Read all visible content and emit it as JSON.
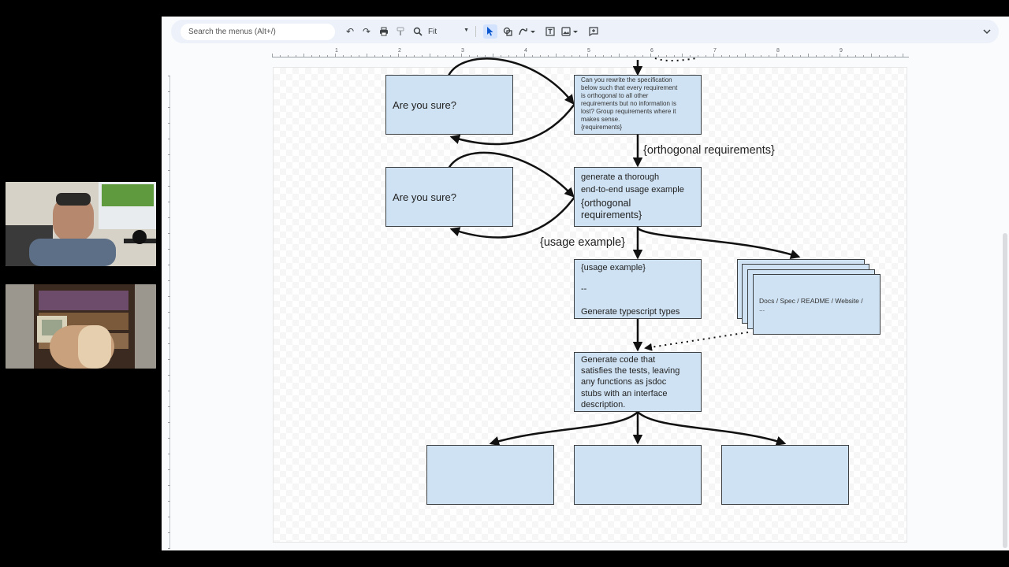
{
  "toolbar": {
    "search_placeholder": "Search the menus (Alt+/)",
    "zoom_value": "Fit"
  },
  "ruler": {
    "labels": [
      "1",
      "2",
      "3",
      "4",
      "5",
      "6",
      "7",
      "8",
      "9"
    ]
  },
  "diagram": {
    "are_you_sure_1": "Are you sure?",
    "are_you_sure_2": "Are you sure?",
    "spec_box": {
      "lines": [
        "Can you rewrite the specification",
        "below such that every requirement",
        "is orthogonal to all other",
        "requirements but no information is",
        "lost? Group requirements where it",
        "makes sense.",
        "{requirements}"
      ]
    },
    "orthogonal_label": "{orthogonal requirements}",
    "usage_box": {
      "line1": "generate a thorough",
      "line2": "end-to-end usage example",
      "line3": "{orthogonal",
      "line4": "requirements}"
    },
    "usage_example_label": "{usage example}",
    "types_box": {
      "line1": "{usage example}",
      "line2": "--",
      "line3": "Generate typescript types"
    },
    "docs_box": {
      "line1": "Docs / Spec / README / Website /",
      "line2": "..."
    },
    "code_box": {
      "lines": [
        "Generate code that",
        "satisfies the tests, leaving",
        "any functions as jsdoc",
        "stubs with an interface",
        "description."
      ]
    }
  },
  "colors": {
    "box_fill": "#cfe2f3",
    "box_border": "#3c4043",
    "toolbar_bg": "#edf2fa",
    "active_tool": "#d3e3fd"
  },
  "icons": {
    "undo": "undo-icon",
    "redo": "redo-icon",
    "print": "print-icon",
    "paint_format": "paint-format-icon",
    "zoom": "zoom-icon",
    "select": "cursor-icon",
    "shape": "shape-icon",
    "line": "line-icon",
    "textbox": "textbox-icon",
    "image": "image-icon",
    "comment": "comment-icon",
    "collapse": "chevron-down-icon"
  }
}
